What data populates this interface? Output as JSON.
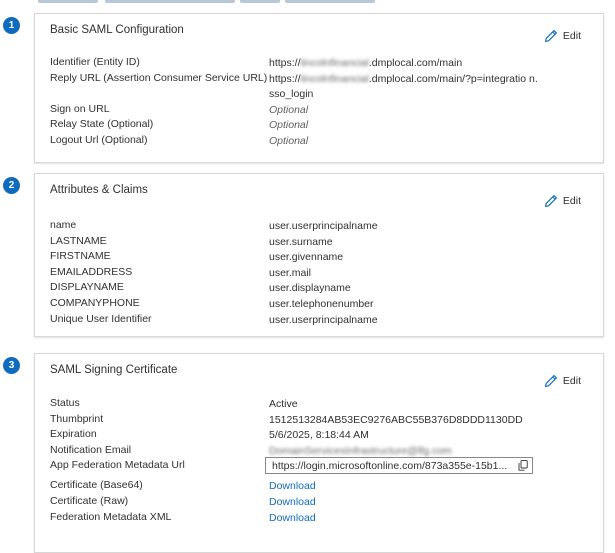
{
  "steps": [
    "1",
    "2",
    "3"
  ],
  "edit_label": "Edit",
  "basic_saml": {
    "title": "Basic SAML Configuration",
    "rows": [
      {
        "label": "Identifier (Entity ID)",
        "value_pre": "https://",
        "value_blur": "lincolnfinancial",
        "value_post": ".dmplocal.com/main"
      },
      {
        "label": "Reply URL (Assertion Consumer Service URL)",
        "value_pre": "https://",
        "value_blur": "lincolnfinancial",
        "value_post": ".dmplocal.com/main/?p=integratio n.sso_login"
      },
      {
        "label": "Sign on URL",
        "value": "Optional"
      },
      {
        "label": "Relay State (Optional)",
        "value": "Optional"
      },
      {
        "label": "Logout Url (Optional)",
        "value": "Optional"
      }
    ]
  },
  "attributes": {
    "title": "Attributes & Claims",
    "rows": [
      {
        "label": "name",
        "value": "user.userprincipalname"
      },
      {
        "label": "LASTNAME",
        "value": "user.surname"
      },
      {
        "label": "FIRSTNAME",
        "value": "user.givenname"
      },
      {
        "label": "EMAILADDRESS",
        "value": "user.mail"
      },
      {
        "label": "DISPLAYNAME",
        "value": "user.displayname"
      },
      {
        "label": "COMPANYPHONE",
        "value": "user.telephonenumber"
      },
      {
        "label": "Unique User Identifier",
        "value": "user.userprincipalname"
      }
    ]
  },
  "certificate": {
    "title": "SAML Signing Certificate",
    "rows": [
      {
        "label": "Status",
        "value": "Active"
      },
      {
        "label": "Thumbprint",
        "value": "1512513284AB53EC9276ABC55B376D8DDD1130DD"
      },
      {
        "label": "Expiration",
        "value": "5/6/2025, 8:18:44 AM"
      },
      {
        "label": "Notification Email",
        "value": "DomainServicesInfrastructure@lfg.com"
      },
      {
        "label": "App Federation Metadata Url",
        "value": "https://login.microsoftonline.com/873a355e-15b1..."
      },
      {
        "label": "Certificate (Base64)",
        "value": "Download"
      },
      {
        "label": "Certificate (Raw)",
        "value": "Download"
      },
      {
        "label": "Federation Metadata XML",
        "value": "Download"
      }
    ]
  },
  "colors": {
    "accent": "#0f6cbd",
    "link": "#0f6cbd",
    "text": "#323130",
    "muted": "#605e5c"
  }
}
